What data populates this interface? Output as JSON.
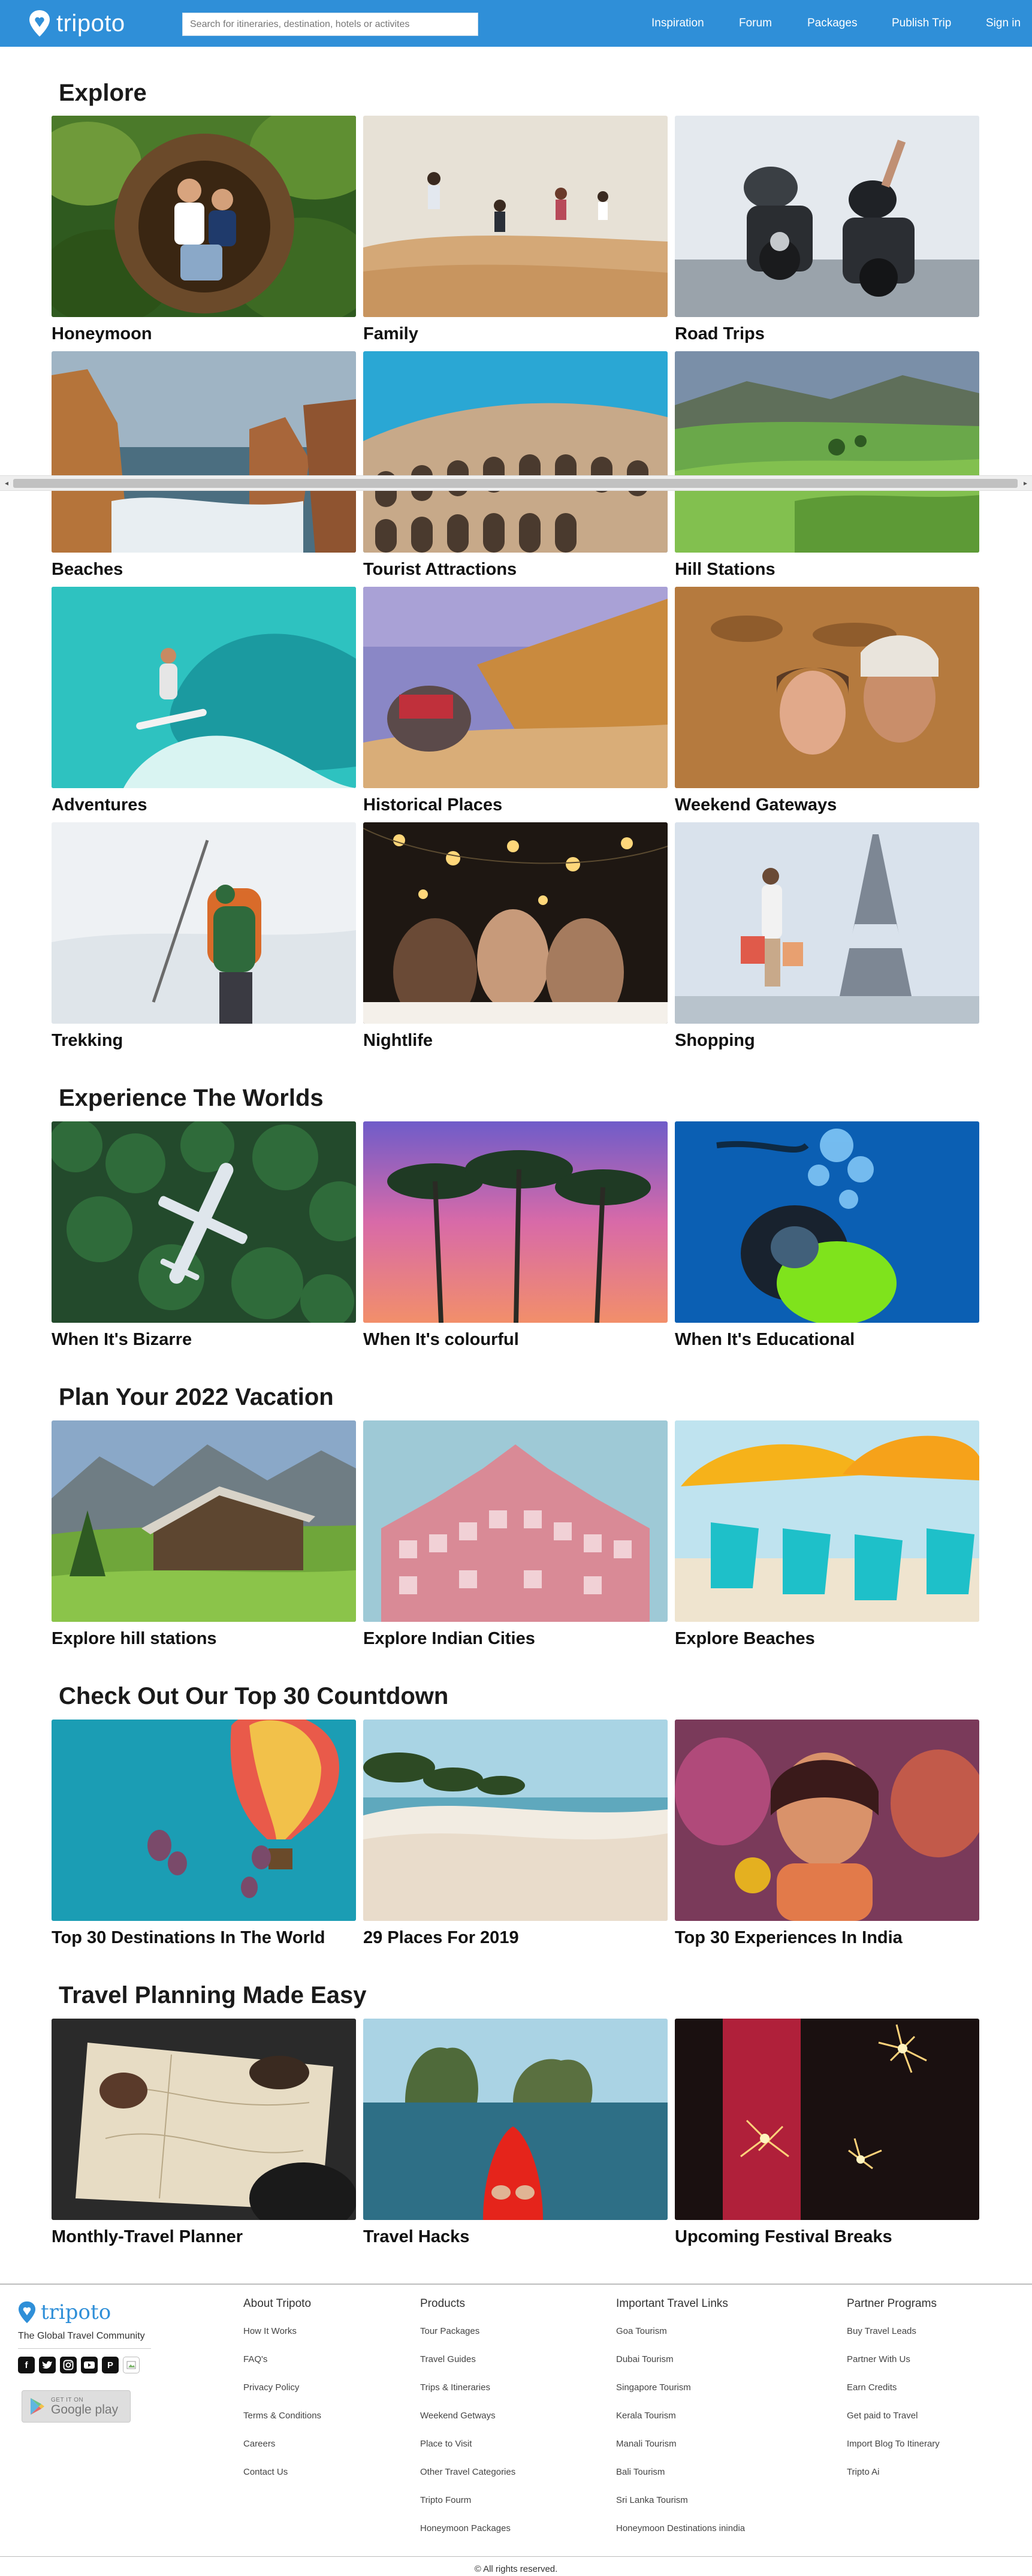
{
  "brand": {
    "name": "tripoto",
    "color": "#2f8fd8"
  },
  "search": {
    "placeholder": "Search for itineraries, destination, hotels or activites"
  },
  "nav": {
    "inspiration": "Inspiration",
    "forum": "Forum",
    "packages": "Packages",
    "publish": "Publish Trip",
    "signin": "Sign in"
  },
  "sections": {
    "explore": {
      "title": "Explore",
      "cards": [
        {
          "label": "Honeymoon",
          "image": "couple-in-nest-swing-jungle"
        },
        {
          "label": "Family",
          "image": "family-jumping-on-dune"
        },
        {
          "label": "Road Trips",
          "image": "motorbike-riders-on-road"
        },
        {
          "label": "Beaches",
          "image": "rocky-coastline-waves"
        },
        {
          "label": "Tourist Attractions",
          "image": "colosseum-blue-sky"
        },
        {
          "label": "Hill Stations",
          "image": "green-rolling-hills"
        },
        {
          "label": "Adventures",
          "image": "surfer-in-barrel-wave"
        },
        {
          "label": "Historical Places",
          "image": "amber-fort-elephant"
        },
        {
          "label": "Weekend Gateways",
          "image": "couple-selfie-desert"
        },
        {
          "label": "Trekking",
          "image": "climber-in-snow"
        },
        {
          "label": "Nightlife",
          "image": "friends-toasting-string-lights"
        },
        {
          "label": "Shopping",
          "image": "woman-with-bags-eiffel-tower"
        }
      ]
    },
    "experience": {
      "title": "Experience The Worlds",
      "cards": [
        {
          "label": "When It's Bizarre",
          "image": "plane-over-forest"
        },
        {
          "label": "When It's colourful",
          "image": "palm-trees-pink-sky"
        },
        {
          "label": "When It's Educational",
          "image": "scuba-diver-blue"
        }
      ]
    },
    "plan": {
      "title": "Plan Your 2022 Vacation",
      "cards": [
        {
          "label": "Explore hill stations",
          "image": "alpine-cabin-meadow"
        },
        {
          "label": "Explore Indian Cities",
          "image": "hawa-mahal-pink"
        },
        {
          "label": "Explore Beaches",
          "image": "beach-loungers-umbrellas"
        }
      ]
    },
    "countdown": {
      "title": "Check Out Our Top 30 Countdown",
      "cards": [
        {
          "label": "Top 30 Destinations In The World",
          "image": "hot-air-balloons"
        },
        {
          "label": "29 Places For 2019",
          "image": "tropical-beach-palms"
        },
        {
          "label": "Top 30 Experiences In India",
          "image": "holi-festival-colors"
        }
      ]
    },
    "planning": {
      "title": "Travel Planning Made Easy",
      "cards": [
        {
          "label": "Monthly-Travel Planner",
          "image": "map-planning-table"
        },
        {
          "label": "Travel Hacks",
          "image": "red-kayak-limestone-islands"
        },
        {
          "label": "Upcoming Festival Breaks",
          "image": "sparklers-festival"
        }
      ]
    }
  },
  "footer": {
    "tagline": "The Global Travel Community",
    "socials": [
      "facebook-icon",
      "twitter-icon",
      "instagram-icon",
      "youtube-icon",
      "pinterest-icon",
      "broken-image-icon"
    ],
    "google_play": {
      "line1": "GET IT ON",
      "line2": "Google play"
    },
    "columns": [
      {
        "heading": "About Tripoto",
        "links": [
          "How It Works",
          "FAQ's",
          "Privacy Policy",
          "Terms & Conditions",
          "Careers",
          "Contact Us"
        ]
      },
      {
        "heading": "Products",
        "links": [
          "Tour Packages",
          "Travel Guides",
          "Trips & Itineraries",
          "Weekend Getways",
          "Place to Visit",
          "Other Travel Categories",
          "Tripto Fourm",
          "Honeymoon Packages"
        ]
      },
      {
        "heading": "Important Travel Links",
        "links": [
          "Goa Tourism",
          "Dubai Tourism",
          "Singapore Tourism",
          "Kerala Tourism",
          "Manali Tourism",
          "Bali Tourism",
          "Sri Lanka Tourism",
          "Honeymoon Destinations inindia"
        ]
      },
      {
        "heading": "Partner Programs",
        "links": [
          "Buy Travel Leads",
          "Partner With Us",
          "Earn Credits",
          "Get paid to Travel",
          "Import Blog To Itinerary",
          "Tripto Ai"
        ]
      }
    ],
    "copyright": "© All rights reserved."
  }
}
